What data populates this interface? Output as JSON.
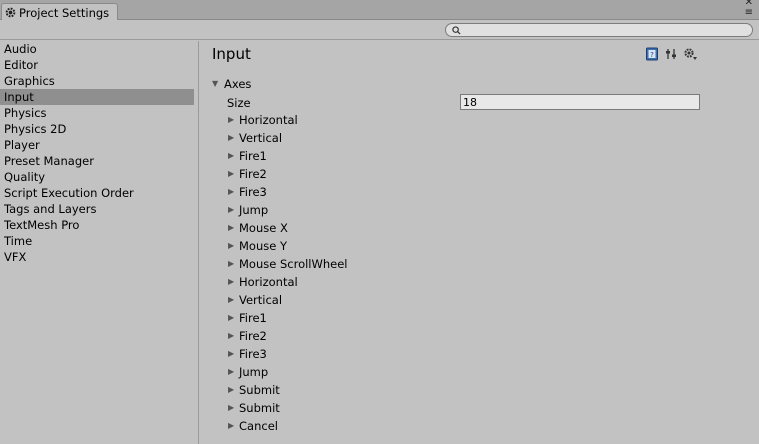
{
  "window": {
    "tab_title": "Project Settings",
    "controls": [
      "≡",
      "✕"
    ]
  },
  "search": {
    "placeholder": "",
    "value": ""
  },
  "sidebar": {
    "items": [
      "Audio",
      "Editor",
      "Graphics",
      "Input",
      "Physics",
      "Physics 2D",
      "Player",
      "Preset Manager",
      "Quality",
      "Script Execution Order",
      "Tags and Layers",
      "TextMesh Pro",
      "Time",
      "VFX"
    ],
    "selected": "Input"
  },
  "main": {
    "title": "Input",
    "axes_label": "Axes",
    "size_label": "Size",
    "size_value": "18",
    "axes": [
      "Horizontal",
      "Vertical",
      "Fire1",
      "Fire2",
      "Fire3",
      "Jump",
      "Mouse X",
      "Mouse Y",
      "Mouse ScrollWheel",
      "Horizontal",
      "Vertical",
      "Fire1",
      "Fire2",
      "Fire3",
      "Jump",
      "Submit",
      "Submit",
      "Cancel"
    ]
  },
  "colors": {
    "background": "#c2c2c2",
    "selected_row": "#8f8f8f",
    "tabbar": "#a5a5a5"
  }
}
